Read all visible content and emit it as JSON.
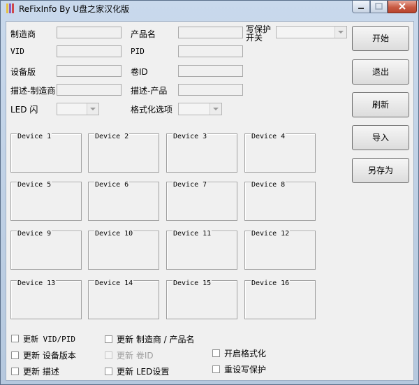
{
  "window": {
    "title": "ReFixInfo By U盘之家汉化版"
  },
  "fields": {
    "manufacturer": {
      "label": "制造商",
      "value": ""
    },
    "product_name": {
      "label": "产品名",
      "value": ""
    },
    "write_protect": {
      "label_line1": "写保护",
      "label_line2": "开关",
      "value": ""
    },
    "vid": {
      "label": "VID",
      "value": ""
    },
    "pid": {
      "label": "PID",
      "value": ""
    },
    "device_version": {
      "label": "设备版",
      "value": ""
    },
    "volume_id": {
      "label": "卷ID",
      "value": ""
    },
    "desc_manufacturer": {
      "label": "描述-制造商",
      "value": ""
    },
    "desc_product": {
      "label": "描述-产品",
      "value": ""
    },
    "led_flash": {
      "label": "LED 闪",
      "value": ""
    },
    "format_option": {
      "label": "格式化选项",
      "value": ""
    }
  },
  "buttons": {
    "start": "开始",
    "exit": "退出",
    "refresh": "刷新",
    "import": "导入",
    "save_as": "另存为"
  },
  "devices": [
    "Device 1",
    "Device 2",
    "Device 3",
    "Device 4",
    "Device 5",
    "Device 6",
    "Device 7",
    "Device 8",
    "Device 9",
    "Device 10",
    "Device 11",
    "Device 12",
    "Device 13",
    "Device 14",
    "Device 15",
    "Device 16"
  ],
  "checkboxes": {
    "update_vid_pid": {
      "label": "更新 VID/PID",
      "checked": false
    },
    "update_manufacturer_product": {
      "label": "更新 制造商 / 产品名",
      "checked": false
    },
    "update_device_version": {
      "label": "更新 设备版本",
      "checked": false
    },
    "update_volume_id": {
      "label": "更新 卷ID",
      "checked": false,
      "disabled": true
    },
    "enable_format": {
      "label": "开启格式化",
      "checked": false
    },
    "update_description": {
      "label": "更新 描述",
      "checked": false
    },
    "update_led": {
      "label": "更新 LED设置",
      "checked": false
    },
    "reset_write_protect": {
      "label": "重设写保护",
      "checked": false
    }
  }
}
